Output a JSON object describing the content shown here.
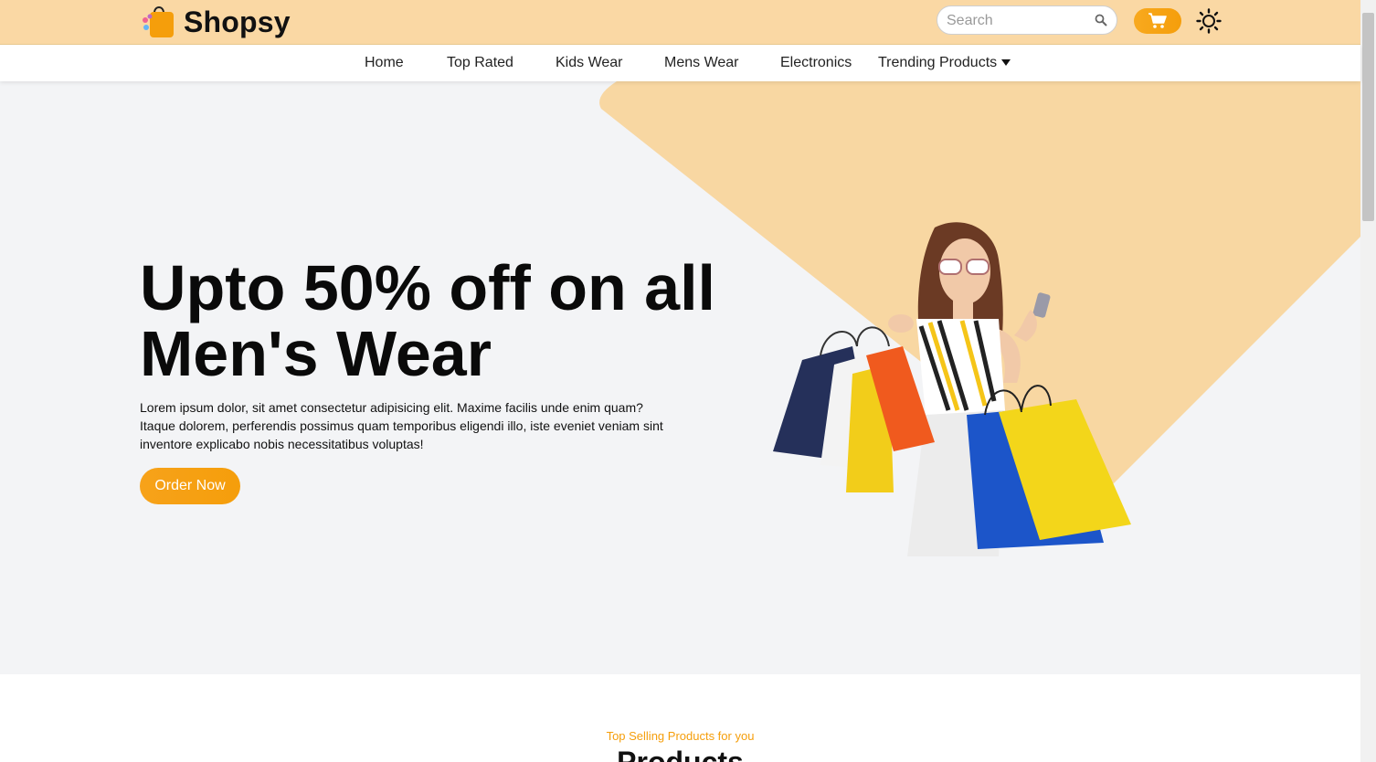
{
  "brand": {
    "name": "Shopsy"
  },
  "search": {
    "placeholder": "Search"
  },
  "nav": {
    "items": [
      "Home",
      "Top Rated",
      "Kids Wear",
      "Mens Wear",
      "Electronics",
      "Trending Products"
    ]
  },
  "hero": {
    "title": "Upto 50% off on all Men's Wear",
    "description": "Lorem ipsum dolor, sit amet consectetur adipisicing elit. Maxime facilis unde enim quam? Itaque dolorem, perferendis possimus quam temporibus eligendi illo, iste eveniet veniam sint inventore explicabo nobis necessitatibus voluptas!",
    "cta": "Order Now"
  },
  "products": {
    "subtitle": "Top Selling Products for you",
    "title": "Products"
  },
  "colors": {
    "header_bg": "#fad8a4",
    "accent": "#f59e0b",
    "hero_bg": "#f3f4f6"
  },
  "icons": {
    "logo": "shopping-bag-icon",
    "search": "search-icon",
    "cart": "cart-icon",
    "theme": "sun-icon",
    "dropdown": "caret-down-icon"
  }
}
